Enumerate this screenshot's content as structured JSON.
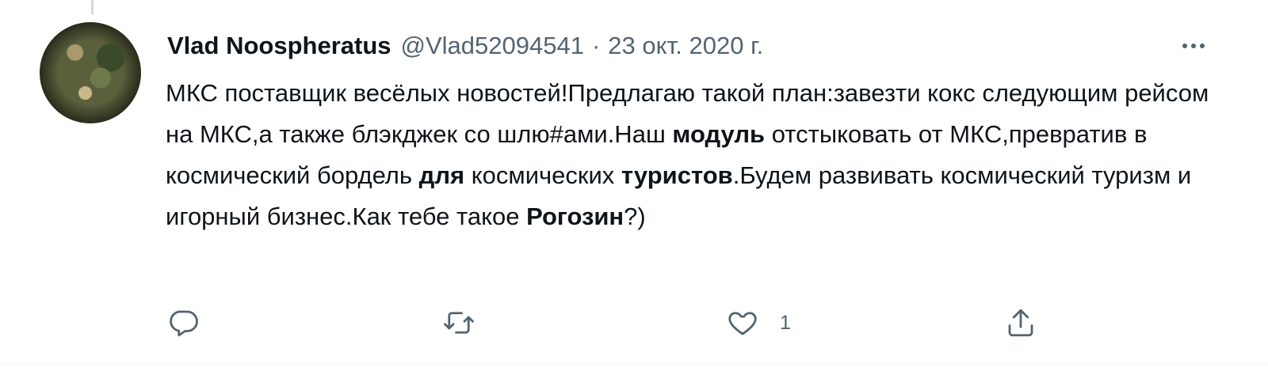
{
  "tweet": {
    "author_name": "Vlad Noospheratus",
    "author_handle": "@Vlad52094541",
    "separator": "·",
    "date": "23 окт. 2020 г.",
    "text_segments": [
      {
        "text": "МКС поставщик весёлых новостей!Предлагаю такой план:завезти кокс следующим рейсом на МКС,а также блэкджек со шлю#ами.Наш ",
        "bold": false
      },
      {
        "text": "модуль",
        "bold": true
      },
      {
        "text": " отстыковать от МКС,превратив в космический бордель ",
        "bold": false
      },
      {
        "text": "для",
        "bold": true
      },
      {
        "text": " космических ",
        "bold": false
      },
      {
        "text": "туристов",
        "bold": true
      },
      {
        "text": ".Будем развивать космический туризм и игорный бизнес.Как тебе такое ",
        "bold": false
      },
      {
        "text": "Рогозин",
        "bold": true
      },
      {
        "text": "?)",
        "bold": false
      }
    ],
    "actions": {
      "reply": {
        "icon": "reply-icon",
        "count": ""
      },
      "retweet": {
        "icon": "retweet-icon",
        "count": ""
      },
      "like": {
        "icon": "heart-icon",
        "count": "1"
      },
      "share": {
        "icon": "share-icon",
        "count": ""
      }
    },
    "more_icon": "more-icon"
  },
  "colors": {
    "text": "#0f1419",
    "secondary": "#536471",
    "border": "#eff3f4"
  }
}
